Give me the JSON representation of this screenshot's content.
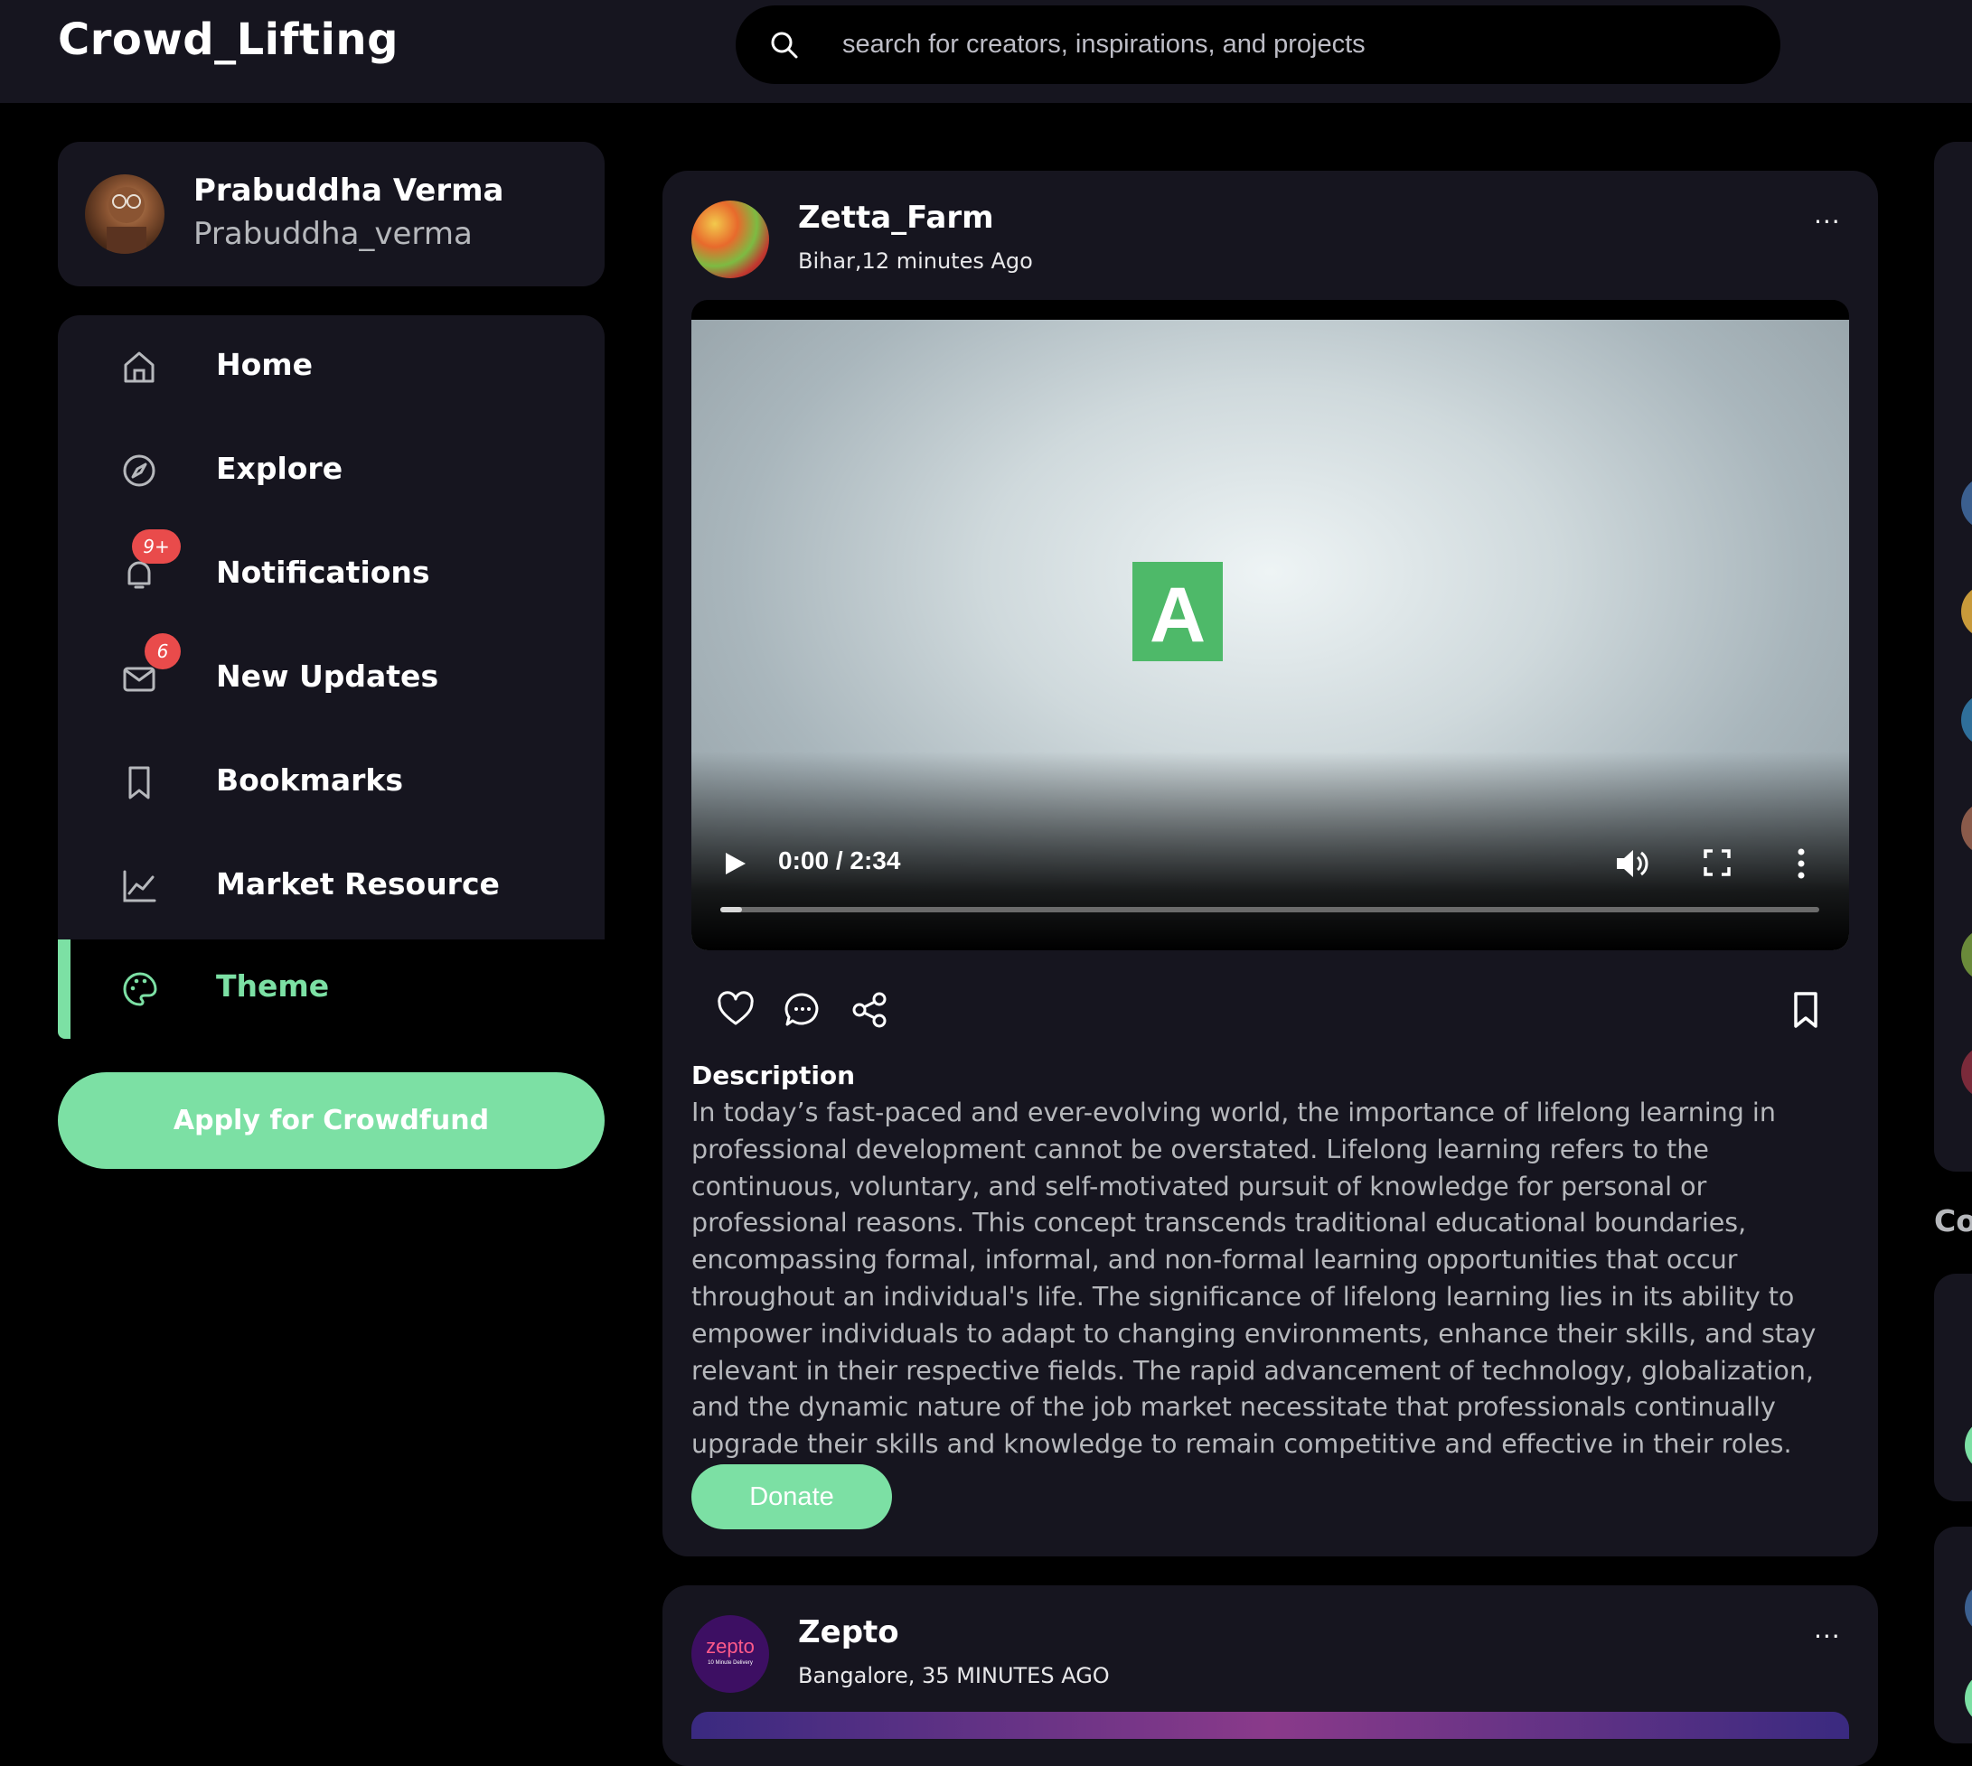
{
  "header": {
    "logo": "Crowd_Lifting",
    "search_placeholder": "search for creators, inspirations, and projects",
    "search_icon": "search-icon"
  },
  "profile": {
    "name": "Prabuddha Verma",
    "handle": "Prabuddha_verma"
  },
  "nav": {
    "items": [
      {
        "label": "Home",
        "icon": "home-icon"
      },
      {
        "label": "Explore",
        "icon": "compass-icon"
      },
      {
        "label": "Notifications",
        "icon": "bell-icon",
        "badge": "9+"
      },
      {
        "label": "New Updates",
        "icon": "mail-icon",
        "badge": "6"
      },
      {
        "label": "Bookmarks",
        "icon": "bookmark-icon"
      },
      {
        "label": "Market Resource",
        "icon": "chart-line-icon"
      },
      {
        "label": "Theme",
        "icon": "palette-icon",
        "active": true
      }
    ],
    "apply_button": "Apply for Crowdfund"
  },
  "posts": [
    {
      "author": "Zetta_Farm",
      "meta": "Bihar,12 minutes Ago",
      "more": "···",
      "video": {
        "time": "0:00 / 2:34",
        "logo_letter": "A",
        "progress": 0.02
      },
      "description_title": "Description",
      "description": "In today’s fast-paced and ever-evolving world, the importance of lifelong learning in professional development cannot be overstated. Lifelong learning refers to the continuous, voluntary, and self-motivated pursuit of knowledge for personal or professional reasons. This concept transcends traditional educational boundaries, encompassing formal, informal, and non-formal learning opportunities that occur throughout an individual's life. The significance of lifelong learning lies in its ability to empower individuals to adapt to changing environments, enhance their skills, and stay relevant in their respective fields. The rapid advancement of technology, globalization, and the dynamic nature of the job market necessitate that professionals continually upgrade their skills and knowledge to remain competitive and effective in their roles.",
      "donate_button": "Donate"
    },
    {
      "author": "Zepto",
      "meta": "Bangalore, 35 MINUTES AGO",
      "more": "···",
      "avatar_text": "zepto",
      "avatar_subtext": "10 Minute Delivery"
    }
  ],
  "right_column": {
    "heading_partial": "Co"
  },
  "colors": {
    "accent": "#7ce0a4",
    "card": "#16151f",
    "background": "#000000",
    "badge": "#e94b4b",
    "muted_text": "#b6b8bc"
  }
}
